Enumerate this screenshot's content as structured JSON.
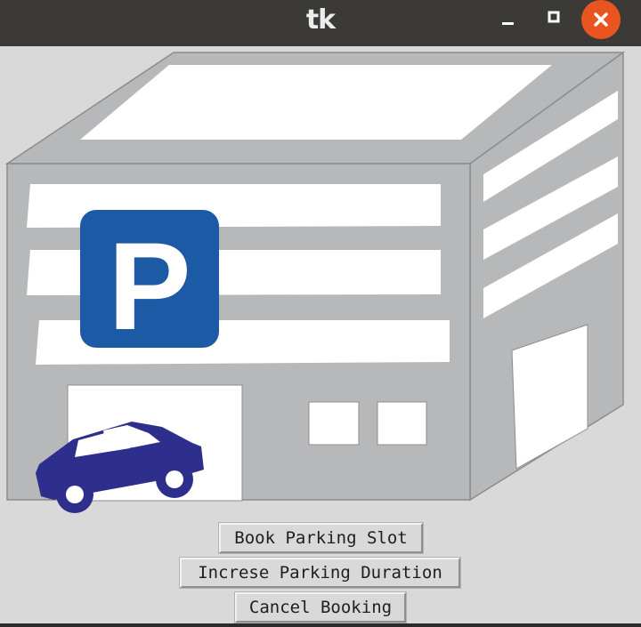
{
  "window": {
    "title": "tk",
    "controls": [
      "minimize-icon",
      "maximize-icon",
      "close-icon"
    ]
  },
  "illustration": {
    "parking_sign_letter": "P",
    "colors": {
      "sign_blue": "#1c5aa6",
      "car_blue": "#2e2e8c",
      "building_gray": "#b6b8b9",
      "close_orange": "#e95420"
    }
  },
  "buttons": {
    "book": "Book Parking Slot",
    "increase": "Increse Parking Duration",
    "cancel": "Cancel Booking"
  }
}
